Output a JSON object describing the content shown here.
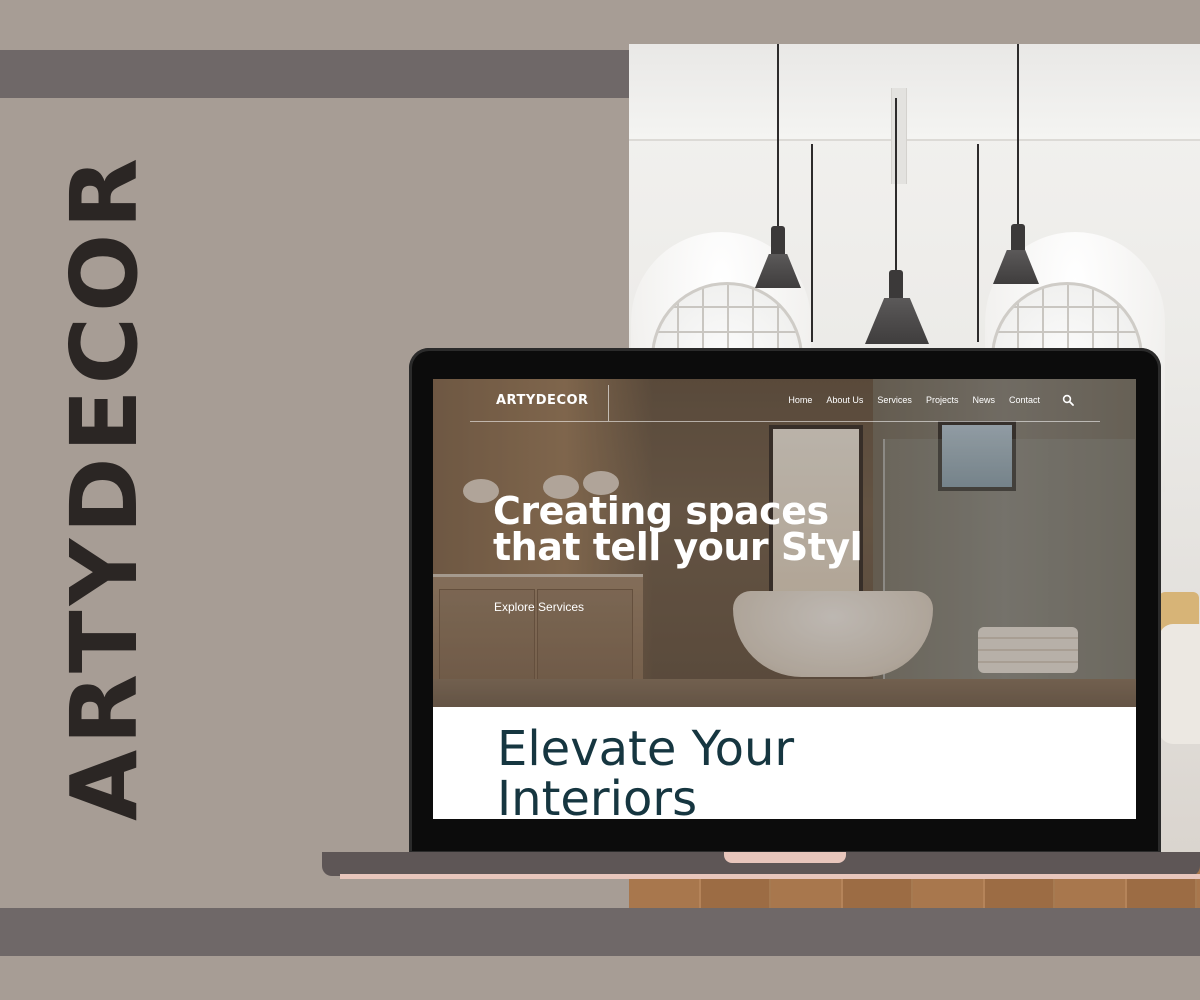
{
  "brand": {
    "vertical_title": "ARTYDECOR"
  },
  "website": {
    "logo": "ARTYDECOR",
    "nav": [
      {
        "label": "Home"
      },
      {
        "label": "About Us"
      },
      {
        "label": "Services"
      },
      {
        "label": "Projects"
      },
      {
        "label": "News"
      },
      {
        "label": "Contact"
      }
    ],
    "search_icon": "search-icon",
    "hero": {
      "headline_line1": "Creating spaces",
      "headline_line2": "that tell your Styl",
      "cta": "Explore Services"
    },
    "section": {
      "title_line1": "Elevate Your",
      "title_line2": "Interiors"
    }
  },
  "colors": {
    "background": "#a79d95",
    "band": "#6f6868",
    "title": "#2b2624",
    "section_title": "#163640",
    "laptop_accent": "#e8c6bc"
  }
}
